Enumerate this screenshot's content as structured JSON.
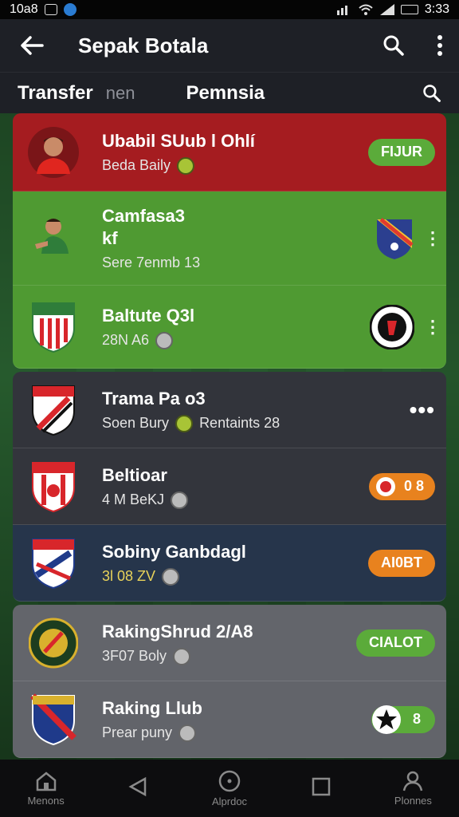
{
  "status_bar": {
    "left_text": "10a8",
    "time": "3:33"
  },
  "app_bar": {
    "title": "Sepak Botala"
  },
  "tabs": [
    {
      "label": "Transfer"
    },
    {
      "label": "nen"
    },
    {
      "label": "Pemnsia"
    }
  ],
  "cards": [
    {
      "name": "Ubabil SUub l Ohlí",
      "sub": "Beda Baily",
      "action": "FIJUR"
    },
    {
      "name": "Camfasa3",
      "name2": "kf",
      "sub": "Sere 7enmb 13"
    },
    {
      "name": "Baltute Q3l",
      "sub": "28N A6"
    },
    {
      "name": "Trama Pa o3",
      "sub": "Soen Bury",
      "sub2": "Rentaints 28"
    },
    {
      "name": "Beltioar",
      "sub": "4 M BeKJ",
      "action": "0 8"
    },
    {
      "name": "Sobiny Ganbdagl",
      "sub": "3l 08 ZV",
      "action": "AI0BT"
    },
    {
      "name": "RakingShrud 2/A8",
      "sub": "3F07 Boly",
      "action": "CIALOT"
    },
    {
      "name": "Raking Llub",
      "sub": "Prear puny",
      "action": "8"
    }
  ],
  "nav": [
    {
      "label": "Menons"
    },
    {
      "label": ""
    },
    {
      "label": "Alprdoc"
    },
    {
      "label": ""
    },
    {
      "label": "Plonnes"
    }
  ],
  "colors": {
    "app_bar": "#1e2026",
    "card_red": "#a51c20",
    "card_green": "#4f9a32",
    "card_dark": "#32343b",
    "card_navy": "#26354b",
    "card_gray": "#63656b",
    "pill_green": "#5bab3a",
    "pill_orange": "#e8821e"
  }
}
